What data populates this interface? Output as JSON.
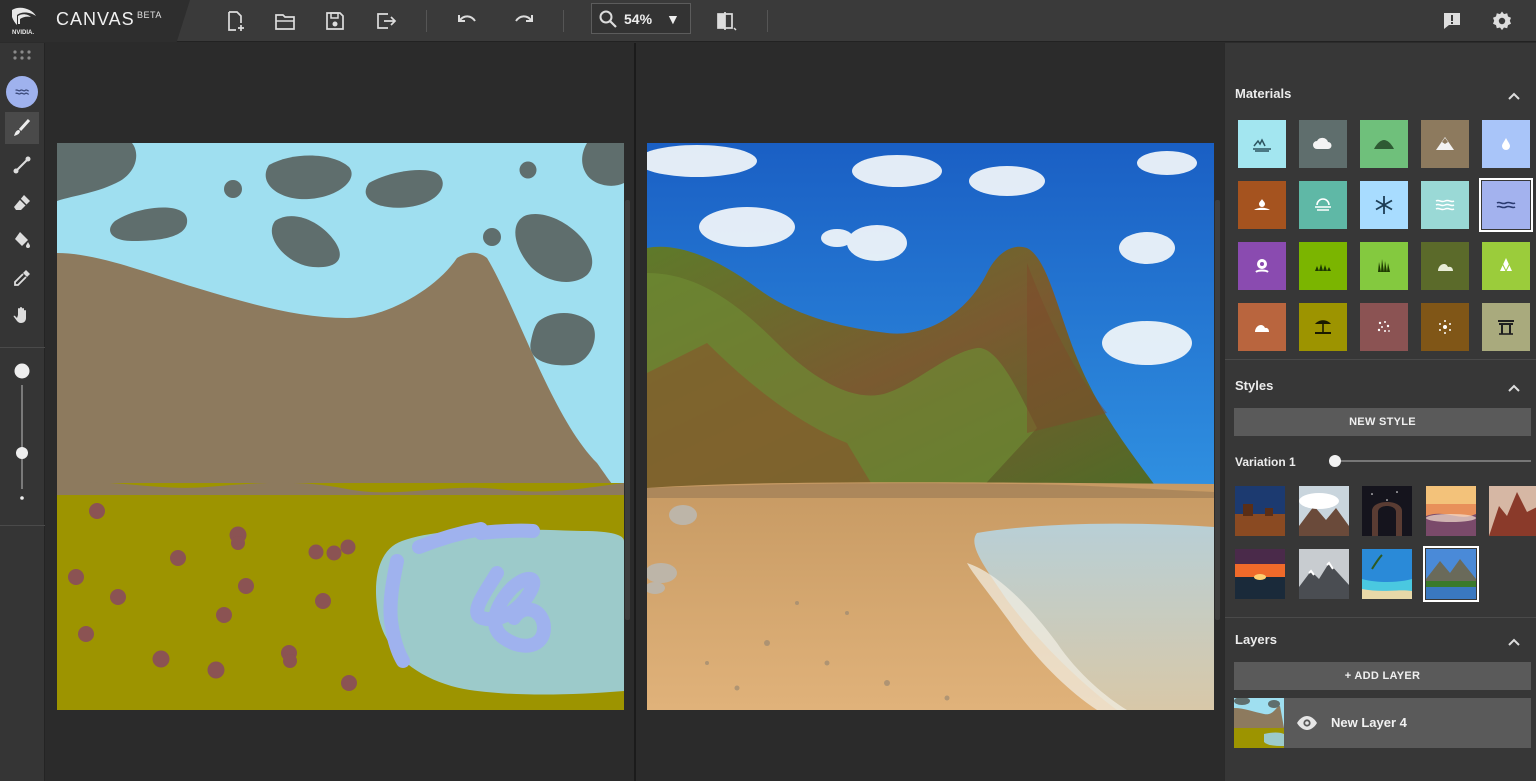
{
  "brand": {
    "logo_text": "NVIDIA.",
    "app_name": "CANVAS",
    "beta": "BETA"
  },
  "toolbar_top": {
    "icons": [
      "new-file-icon",
      "open-folder-icon",
      "save-icon",
      "export-icon",
      "undo-icon",
      "redo-icon",
      "search-icon",
      "compare-view-icon",
      "feedback-icon",
      "settings-gear-icon"
    ],
    "zoom": "54%",
    "zoom_dropdown_glyph": "▼"
  },
  "tools": [
    "material-brush",
    "paint-brush",
    "line",
    "eraser",
    "paint-bucket",
    "eyedropper",
    "pan-hand"
  ],
  "materials": {
    "title": "Materials",
    "active": "water",
    "items": [
      {
        "name": "sea",
        "color": "#a3e6f0",
        "icon": "sea-icon"
      },
      {
        "name": "cloud",
        "color": "#5f6e6d",
        "icon": "cloud-icon"
      },
      {
        "name": "grass-hill",
        "color": "#6fc07b",
        "icon": "hill-icon"
      },
      {
        "name": "mountain",
        "color": "#8d7a5e",
        "icon": "mountain-icon"
      },
      {
        "name": "rain",
        "color": "#a9c5f9",
        "icon": "droplet-icon"
      },
      {
        "name": "dirt",
        "color": "#a5531f",
        "icon": "dirt-icon"
      },
      {
        "name": "fog",
        "color": "#5fb8a6",
        "icon": "fog-icon"
      },
      {
        "name": "snow",
        "color": "#a8dcff",
        "icon": "snowflake-icon"
      },
      {
        "name": "river",
        "color": "#9ad9d6",
        "icon": "waves-icon"
      },
      {
        "name": "water",
        "color": "#a3b2ee",
        "icon": "water-icon"
      },
      {
        "name": "flower",
        "color": "#8a4bb0",
        "icon": "flower-icon"
      },
      {
        "name": "grass",
        "color": "#7bb500",
        "icon": "grass-icon"
      },
      {
        "name": "tall-grass",
        "color": "#84c93f",
        "icon": "tall-grass-icon"
      },
      {
        "name": "bush",
        "color": "#5b6a2a",
        "icon": "bush-icon"
      },
      {
        "name": "tree",
        "color": "#9bcc3b",
        "icon": "tree-icon"
      },
      {
        "name": "rock",
        "color": "#b9653e",
        "icon": "rock-icon"
      },
      {
        "name": "sand",
        "color": "#9d9400",
        "icon": "beach-icon"
      },
      {
        "name": "gravel",
        "color": "#8b5353",
        "icon": "gravel-icon"
      },
      {
        "name": "stone",
        "color": "#805617",
        "icon": "stone-icon"
      },
      {
        "name": "bridge",
        "color": "#a9aa7d",
        "icon": "bridge-icon"
      }
    ]
  },
  "styles": {
    "title": "Styles",
    "new_style_label": "NEW STYLE",
    "variation_label": "Variation 1",
    "variation_value": 0,
    "thumbnails": [
      {
        "name": "desert-mesa"
      },
      {
        "name": "cloudy-peaks"
      },
      {
        "name": "night-arch"
      },
      {
        "name": "misty-sunrise"
      },
      {
        "name": "red-rocks"
      },
      {
        "name": "ocean-sunset"
      },
      {
        "name": "snowy-mountains"
      },
      {
        "name": "tropical-beach"
      },
      {
        "name": "alpine-lake"
      }
    ],
    "selected": "alpine-lake"
  },
  "layers": {
    "title": "Layers",
    "add_label": "+ ADD LAYER",
    "items": [
      {
        "name": "New Layer 4",
        "visible": true
      }
    ]
  },
  "colors": {
    "accent": "#a3b2ee",
    "panel": "#373737",
    "topbar": "#3a3a3a"
  }
}
